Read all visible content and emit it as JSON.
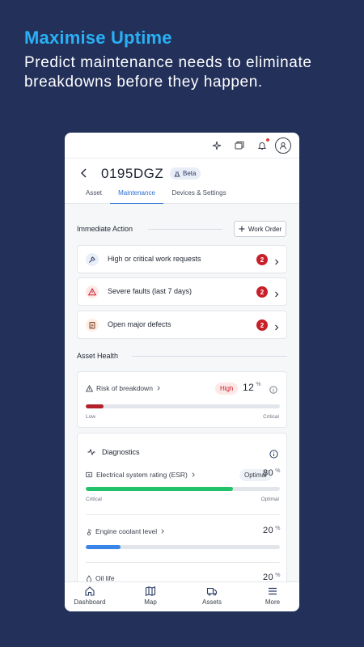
{
  "promo": {
    "title": "Maximise Uptime",
    "subtitle": "Predict maintenance needs to eliminate breakdowns before they happen."
  },
  "header": {
    "asset_id": "0195DGZ",
    "badge": "Beta",
    "tabs": [
      {
        "label": "Asset",
        "active": false
      },
      {
        "label": "Maintenance",
        "active": true
      },
      {
        "label": "Devices & Settings",
        "active": false
      }
    ]
  },
  "immediate_action": {
    "title": "Immediate Action",
    "work_order_label": "Work Order",
    "items": [
      {
        "label": "High or critical work requests",
        "count": "2",
        "icon": "wrench-icon"
      },
      {
        "label": "Severe faults (last 7 days)",
        "count": "2",
        "icon": "warning-icon"
      },
      {
        "label": "Open major defects",
        "count": "2",
        "icon": "clipboard-icon"
      }
    ]
  },
  "asset_health": {
    "title": "Asset Health",
    "risk": {
      "label": "Risk of breakdown",
      "status": "High",
      "value": "12",
      "unit": "%",
      "fill_fraction": 0.09,
      "scale_min": "Low",
      "scale_max": "Critical"
    }
  },
  "diagnostics": {
    "title": "Diagnostics",
    "metrics": [
      {
        "label": "Electrical system rating (ESR)",
        "status": "Optimal",
        "value": "80",
        "unit": "%",
        "fill_fraction": 0.76,
        "scale_min": "Critical",
        "scale_max": "Optimal",
        "color": "#22c26b"
      },
      {
        "label": "Engine coolant level",
        "value": "20",
        "unit": "%",
        "fill_fraction": 0.18,
        "color": "#3a86e8"
      },
      {
        "label": "Oil life",
        "value": "20",
        "unit": "%"
      }
    ]
  },
  "bottom_nav": [
    {
      "label": "Dashboard",
      "icon": "home-icon"
    },
    {
      "label": "Map",
      "icon": "map-icon"
    },
    {
      "label": "Assets",
      "icon": "truck-icon"
    },
    {
      "label": "More",
      "icon": "menu-icon"
    }
  ],
  "colors": {
    "background": "#22305a",
    "accent": "#2ab0f5",
    "primary": "#2a6fd6",
    "danger": "#c8202a"
  }
}
